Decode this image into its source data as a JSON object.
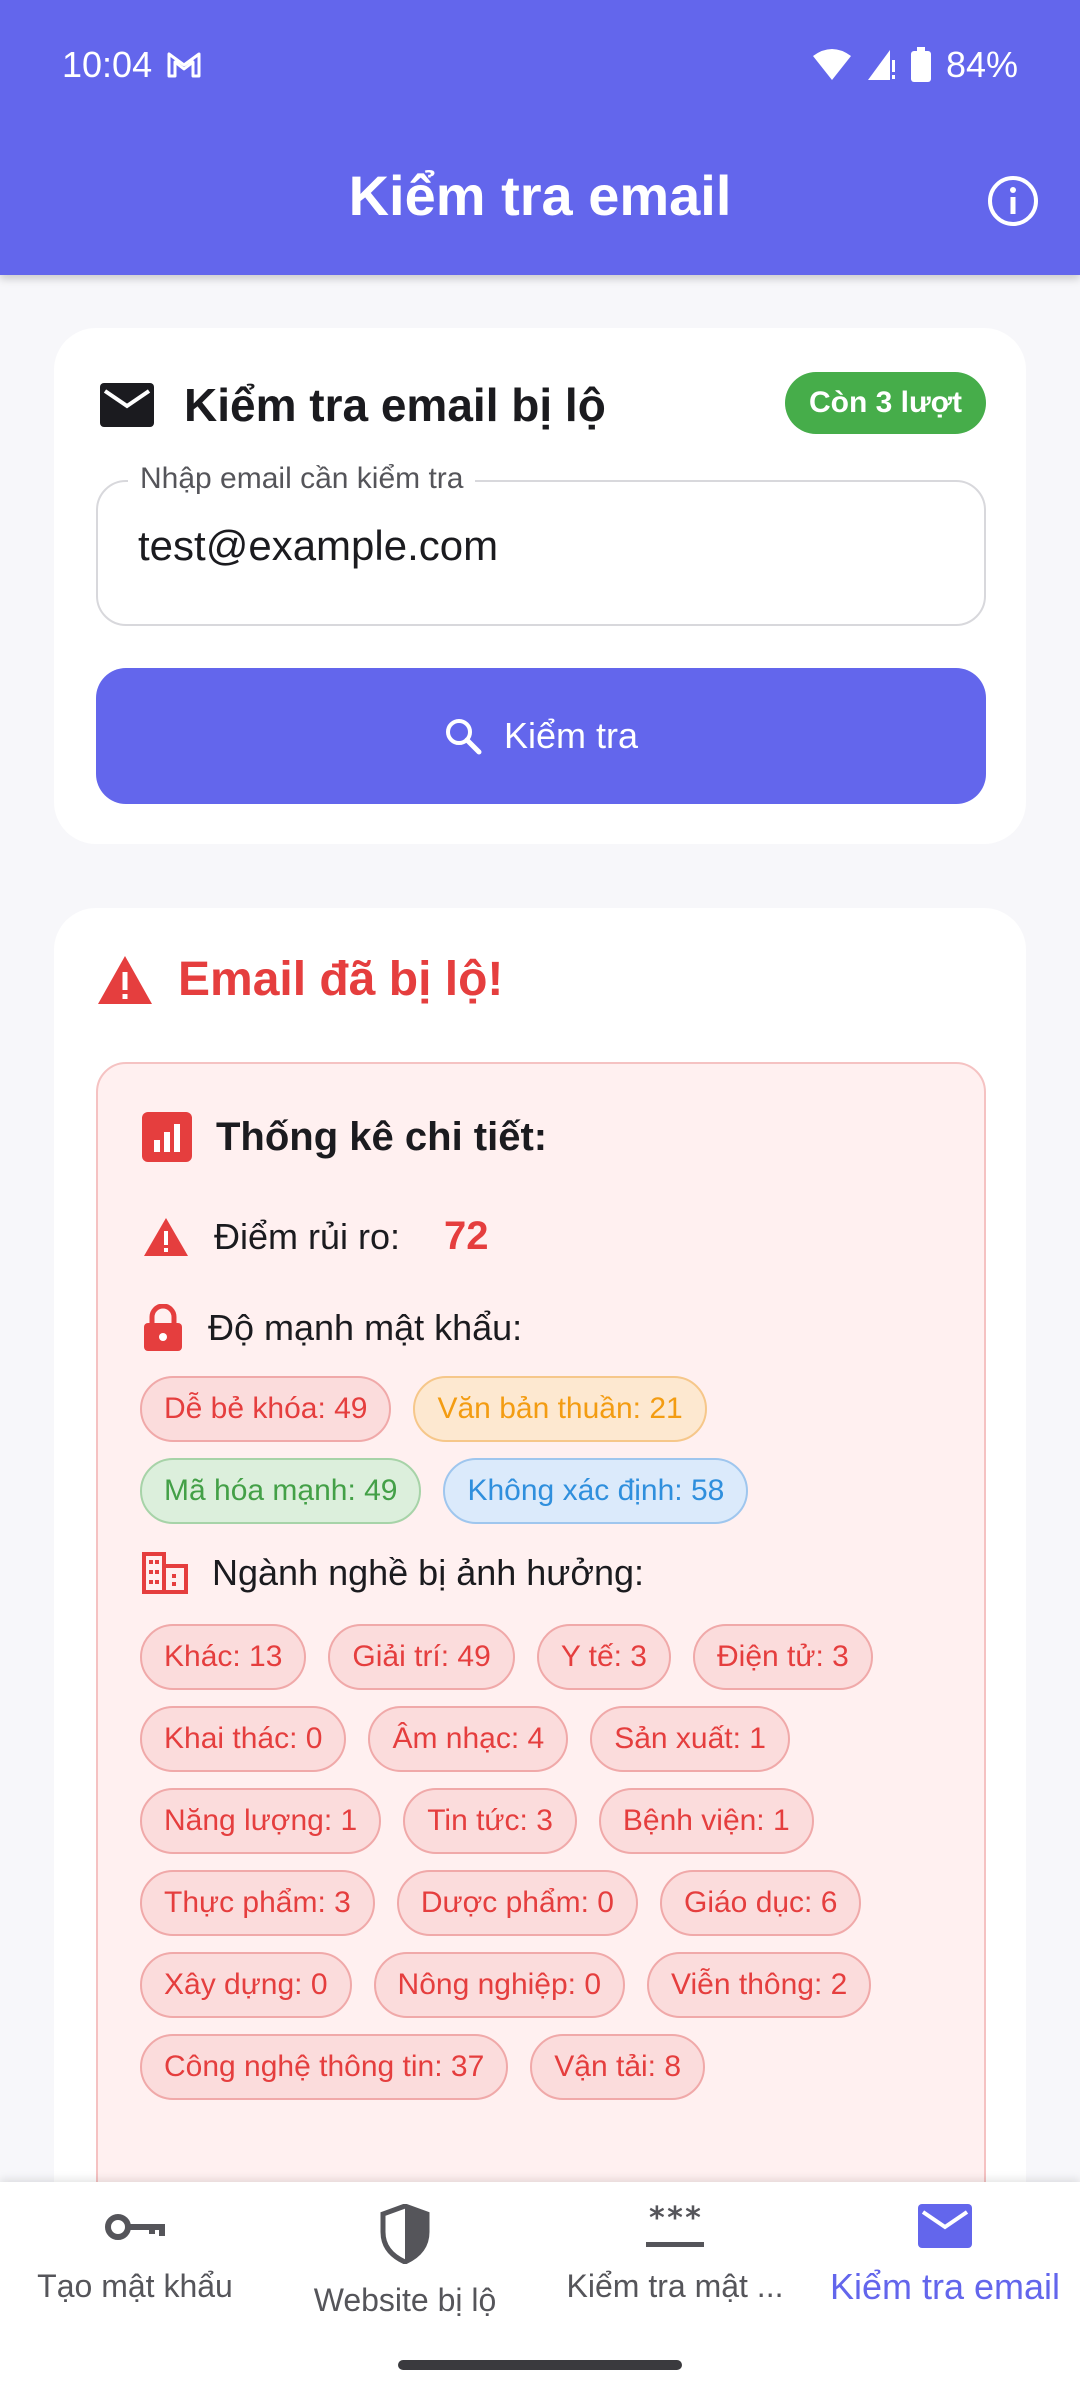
{
  "status_bar": {
    "time": "10:04",
    "mail_icon": "gmail-icon",
    "battery": "84%"
  },
  "app_bar": {
    "title": "Kiểm tra email",
    "info_icon": "info-icon"
  },
  "check_card": {
    "title": "Kiểm tra email bị lộ",
    "quota_badge": "Còn 3 lượt",
    "input_label": "Nhập email cần kiểm tra",
    "input_value": "test@example.com",
    "button_label": "Kiểm tra"
  },
  "result_card": {
    "alert_title": "Email đã bị lộ!",
    "stats_title": "Thống kê chi tiết:",
    "risk_label": "Điểm rủi ro:",
    "risk_value": "72",
    "password_strength_label": "Độ mạnh mật khẩu:",
    "password_strength": [
      {
        "label": "Dễ bẻ khóa: 49",
        "color": "#e53e3e"
      },
      {
        "label": "Văn bản thuần: 21",
        "color": "#f39c12"
      },
      {
        "label": "Mã hóa mạnh: 49",
        "color": "#43a047"
      },
      {
        "label": "Không xác định: 58",
        "color": "#2f8fdd"
      }
    ],
    "industries_label": "Ngành nghề bị ảnh hưởng:",
    "industries": [
      "Khác: 13",
      "Giải trí: 49",
      "Y tế: 3",
      "Điện tử: 3",
      "Khai thác: 0",
      "Âm nhạc: 4",
      "Sản xuất: 1",
      "Năng lượng: 1",
      "Tin tức: 3",
      "Bệnh viện: 1",
      "Thực phẩm: 3",
      "Dược phẩm: 0",
      "Giáo dục: 6",
      "Xây dựng: 0",
      "Nông nghiệp: 0",
      "Viễn thông: 2",
      "Công nghệ thông tin: 37",
      "Vận tải: 8"
    ]
  },
  "bottom_nav": [
    {
      "label": "Tạo mật khẩu",
      "icon": "key-icon",
      "active": false
    },
    {
      "label": "Website bị lộ",
      "icon": "shield-icon",
      "active": false
    },
    {
      "label": "Kiểm tra mật ...",
      "icon": "password-icon",
      "active": false
    },
    {
      "label": "Kiểm tra email",
      "icon": "mail-icon",
      "active": true
    }
  ],
  "colors": {
    "primary": "#6366ec",
    "danger": "#e53e3e",
    "success": "#46ad4a"
  }
}
